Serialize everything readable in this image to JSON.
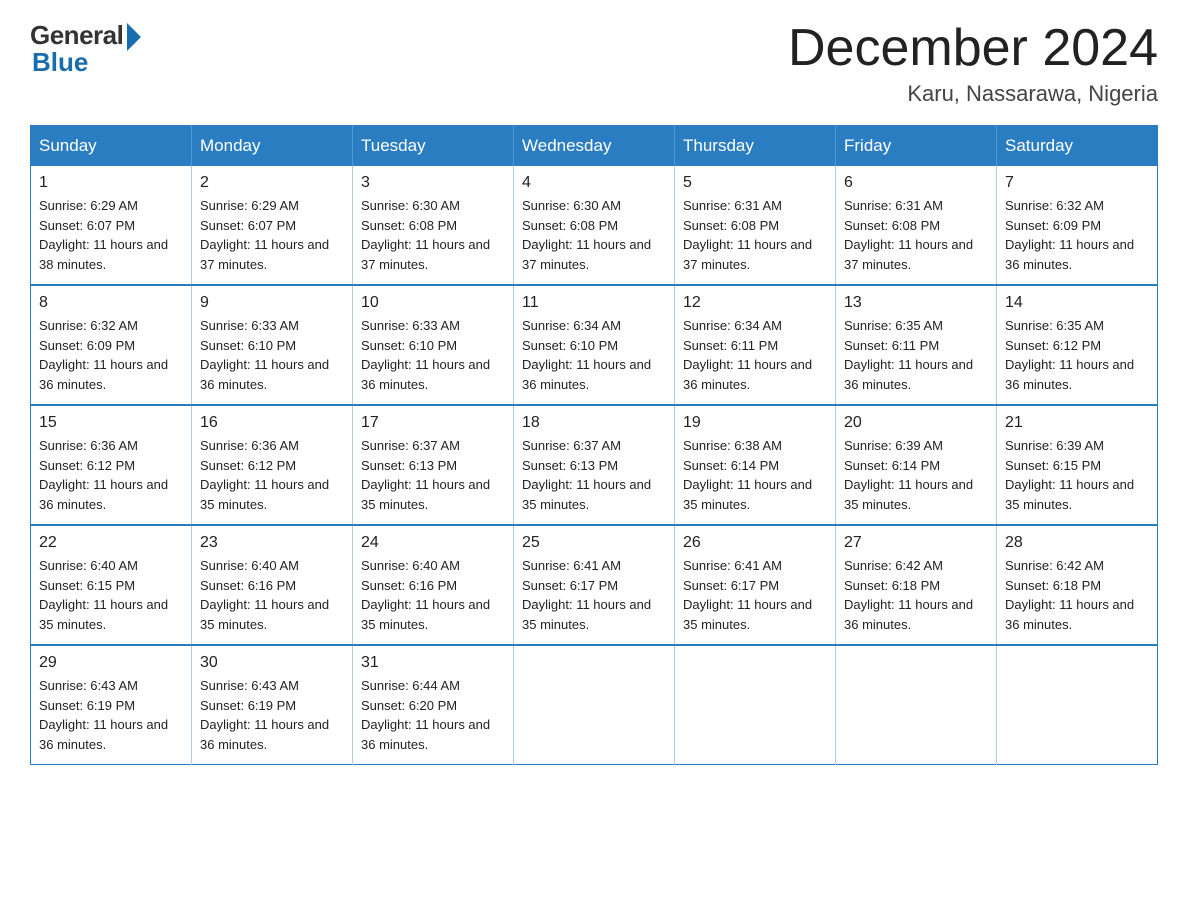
{
  "logo": {
    "general": "General",
    "blue": "Blue"
  },
  "title": {
    "month": "December 2024",
    "location": "Karu, Nassarawa, Nigeria"
  },
  "headers": [
    "Sunday",
    "Monday",
    "Tuesday",
    "Wednesday",
    "Thursday",
    "Friday",
    "Saturday"
  ],
  "weeks": [
    [
      {
        "day": "1",
        "sunrise": "6:29 AM",
        "sunset": "6:07 PM",
        "daylight": "11 hours and 38 minutes."
      },
      {
        "day": "2",
        "sunrise": "6:29 AM",
        "sunset": "6:07 PM",
        "daylight": "11 hours and 37 minutes."
      },
      {
        "day": "3",
        "sunrise": "6:30 AM",
        "sunset": "6:08 PM",
        "daylight": "11 hours and 37 minutes."
      },
      {
        "day": "4",
        "sunrise": "6:30 AM",
        "sunset": "6:08 PM",
        "daylight": "11 hours and 37 minutes."
      },
      {
        "day": "5",
        "sunrise": "6:31 AM",
        "sunset": "6:08 PM",
        "daylight": "11 hours and 37 minutes."
      },
      {
        "day": "6",
        "sunrise": "6:31 AM",
        "sunset": "6:08 PM",
        "daylight": "11 hours and 37 minutes."
      },
      {
        "day": "7",
        "sunrise": "6:32 AM",
        "sunset": "6:09 PM",
        "daylight": "11 hours and 36 minutes."
      }
    ],
    [
      {
        "day": "8",
        "sunrise": "6:32 AM",
        "sunset": "6:09 PM",
        "daylight": "11 hours and 36 minutes."
      },
      {
        "day": "9",
        "sunrise": "6:33 AM",
        "sunset": "6:10 PM",
        "daylight": "11 hours and 36 minutes."
      },
      {
        "day": "10",
        "sunrise": "6:33 AM",
        "sunset": "6:10 PM",
        "daylight": "11 hours and 36 minutes."
      },
      {
        "day": "11",
        "sunrise": "6:34 AM",
        "sunset": "6:10 PM",
        "daylight": "11 hours and 36 minutes."
      },
      {
        "day": "12",
        "sunrise": "6:34 AM",
        "sunset": "6:11 PM",
        "daylight": "11 hours and 36 minutes."
      },
      {
        "day": "13",
        "sunrise": "6:35 AM",
        "sunset": "6:11 PM",
        "daylight": "11 hours and 36 minutes."
      },
      {
        "day": "14",
        "sunrise": "6:35 AM",
        "sunset": "6:12 PM",
        "daylight": "11 hours and 36 minutes."
      }
    ],
    [
      {
        "day": "15",
        "sunrise": "6:36 AM",
        "sunset": "6:12 PM",
        "daylight": "11 hours and 36 minutes."
      },
      {
        "day": "16",
        "sunrise": "6:36 AM",
        "sunset": "6:12 PM",
        "daylight": "11 hours and 35 minutes."
      },
      {
        "day": "17",
        "sunrise": "6:37 AM",
        "sunset": "6:13 PM",
        "daylight": "11 hours and 35 minutes."
      },
      {
        "day": "18",
        "sunrise": "6:37 AM",
        "sunset": "6:13 PM",
        "daylight": "11 hours and 35 minutes."
      },
      {
        "day": "19",
        "sunrise": "6:38 AM",
        "sunset": "6:14 PM",
        "daylight": "11 hours and 35 minutes."
      },
      {
        "day": "20",
        "sunrise": "6:39 AM",
        "sunset": "6:14 PM",
        "daylight": "11 hours and 35 minutes."
      },
      {
        "day": "21",
        "sunrise": "6:39 AM",
        "sunset": "6:15 PM",
        "daylight": "11 hours and 35 minutes."
      }
    ],
    [
      {
        "day": "22",
        "sunrise": "6:40 AM",
        "sunset": "6:15 PM",
        "daylight": "11 hours and 35 minutes."
      },
      {
        "day": "23",
        "sunrise": "6:40 AM",
        "sunset": "6:16 PM",
        "daylight": "11 hours and 35 minutes."
      },
      {
        "day": "24",
        "sunrise": "6:40 AM",
        "sunset": "6:16 PM",
        "daylight": "11 hours and 35 minutes."
      },
      {
        "day": "25",
        "sunrise": "6:41 AM",
        "sunset": "6:17 PM",
        "daylight": "11 hours and 35 minutes."
      },
      {
        "day": "26",
        "sunrise": "6:41 AM",
        "sunset": "6:17 PM",
        "daylight": "11 hours and 35 minutes."
      },
      {
        "day": "27",
        "sunrise": "6:42 AM",
        "sunset": "6:18 PM",
        "daylight": "11 hours and 36 minutes."
      },
      {
        "day": "28",
        "sunrise": "6:42 AM",
        "sunset": "6:18 PM",
        "daylight": "11 hours and 36 minutes."
      }
    ],
    [
      {
        "day": "29",
        "sunrise": "6:43 AM",
        "sunset": "6:19 PM",
        "daylight": "11 hours and 36 minutes."
      },
      {
        "day": "30",
        "sunrise": "6:43 AM",
        "sunset": "6:19 PM",
        "daylight": "11 hours and 36 minutes."
      },
      {
        "day": "31",
        "sunrise": "6:44 AM",
        "sunset": "6:20 PM",
        "daylight": "11 hours and 36 minutes."
      },
      null,
      null,
      null,
      null
    ]
  ]
}
